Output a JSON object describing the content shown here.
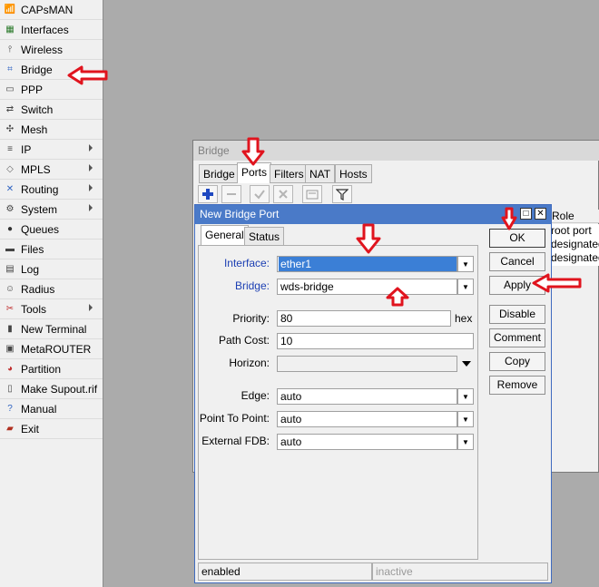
{
  "sidebar": {
    "items": [
      {
        "label": "CAPsMAN",
        "icon": "capsman-icon",
        "submenu": false
      },
      {
        "label": "Interfaces",
        "icon": "interfaces-icon",
        "submenu": false
      },
      {
        "label": "Wireless",
        "icon": "wireless-icon",
        "submenu": false
      },
      {
        "label": "Bridge",
        "icon": "bridge-icon",
        "submenu": false
      },
      {
        "label": "PPP",
        "icon": "ppp-icon",
        "submenu": false
      },
      {
        "label": "Switch",
        "icon": "switch-icon",
        "submenu": false
      },
      {
        "label": "Mesh",
        "icon": "mesh-icon",
        "submenu": false
      },
      {
        "label": "IP",
        "icon": "ip-icon",
        "submenu": true
      },
      {
        "label": "MPLS",
        "icon": "mpls-icon",
        "submenu": true
      },
      {
        "label": "Routing",
        "icon": "routing-icon",
        "submenu": true
      },
      {
        "label": "System",
        "icon": "system-icon",
        "submenu": true
      },
      {
        "label": "Queues",
        "icon": "queues-icon",
        "submenu": false
      },
      {
        "label": "Files",
        "icon": "files-icon",
        "submenu": false
      },
      {
        "label": "Log",
        "icon": "log-icon",
        "submenu": false
      },
      {
        "label": "Radius",
        "icon": "radius-icon",
        "submenu": false
      },
      {
        "label": "Tools",
        "icon": "tools-icon",
        "submenu": true
      },
      {
        "label": "New Terminal",
        "icon": "terminal-icon",
        "submenu": false
      },
      {
        "label": "MetaROUTER",
        "icon": "metarouter-icon",
        "submenu": false
      },
      {
        "label": "Partition",
        "icon": "partition-icon",
        "submenu": false
      },
      {
        "label": "Make Supout.rif",
        "icon": "supout-icon",
        "submenu": false
      },
      {
        "label": "Manual",
        "icon": "manual-icon",
        "submenu": false
      },
      {
        "label": "Exit",
        "icon": "exit-icon",
        "submenu": false
      }
    ]
  },
  "bridge_window": {
    "title": "Bridge",
    "tabs": [
      "Bridge",
      "Ports",
      "Filters",
      "NAT",
      "Hosts"
    ],
    "active_tab": "Ports",
    "role_header": "Role",
    "roles": [
      "root port",
      "designated",
      "designated"
    ]
  },
  "dialog": {
    "title": "New Bridge Port",
    "tabs": [
      "General",
      "Status"
    ],
    "active_tab": "General",
    "fields": {
      "interface": {
        "label": "Interface:",
        "value": "ether1"
      },
      "bridge": {
        "label": "Bridge:",
        "value": "wds-bridge"
      },
      "priority": {
        "label": "Priority:",
        "value": "80",
        "suffix": "hex"
      },
      "path_cost": {
        "label": "Path Cost:",
        "value": "10"
      },
      "horizon": {
        "label": "Horizon:",
        "value": ""
      },
      "edge": {
        "label": "Edge:",
        "value": "auto"
      },
      "point_to_point": {
        "label": "Point To Point:",
        "value": "auto"
      },
      "external_fdb": {
        "label": "External FDB:",
        "value": "auto"
      }
    },
    "buttons": {
      "ok": "OK",
      "cancel": "Cancel",
      "apply": "Apply",
      "disable": "Disable",
      "comment": "Comment",
      "copy": "Copy",
      "remove": "Remove"
    },
    "status_left": "enabled",
    "status_right": "inactive"
  },
  "colors": {
    "accent_title": "#4a7ac8",
    "selection": "#3b7fd6",
    "annotation_arrow": "#e0141e",
    "field_label_blue": "#1c3fb3"
  }
}
